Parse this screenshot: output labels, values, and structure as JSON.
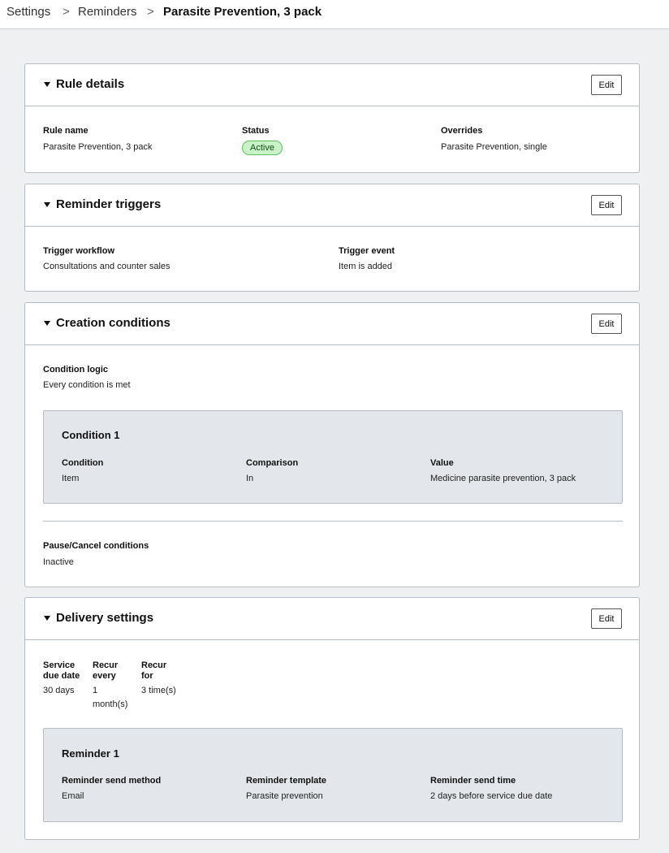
{
  "breadcrumb": {
    "items": [
      "Settings",
      "Reminders"
    ],
    "current": "Parasite Prevention, 3 pack",
    "separator": ">"
  },
  "edit_label": "Edit",
  "rule_details": {
    "title": "Rule details",
    "rule_name_label": "Rule name",
    "rule_name_value": "Parasite Prevention, 3 pack",
    "status_label": "Status",
    "status_value": "Active",
    "overrides_label": "Overrides",
    "overrides_value": "Parasite Prevention, single"
  },
  "reminder_triggers": {
    "title": "Reminder triggers",
    "workflow_label": "Trigger workflow",
    "workflow_value": "Consultations and counter sales",
    "event_label": "Trigger event",
    "event_value": "Item is added"
  },
  "creation_conditions": {
    "title": "Creation conditions",
    "logic_label": "Condition logic",
    "logic_value": "Every condition is met",
    "condition": {
      "title": "Condition 1",
      "condition_label": "Condition",
      "condition_value": "Item",
      "comparison_label": "Comparison",
      "comparison_value": "In",
      "value_label": "Value",
      "value_value": "Medicine parasite prevention, 3 pack"
    },
    "pause_label": "Pause/Cancel conditions",
    "pause_value": "Inactive"
  },
  "delivery_settings": {
    "title": "Delivery settings",
    "due_label_1": "Service",
    "due_label_2": "due date",
    "due_value": "30 days",
    "recur_every_label_1": "Recur",
    "recur_every_label_2": "every",
    "recur_every_value_1": "1",
    "recur_every_value_2": "month(s)",
    "recur_for_label_1": "Recur",
    "recur_for_label_2": "for",
    "recur_for_value": "3 time(s)",
    "reminder": {
      "title": "Reminder 1",
      "method_label": "Reminder send method",
      "method_value": "Email",
      "template_label": "Reminder template",
      "template_value": "Parasite prevention",
      "time_label": "Reminder send time",
      "time_value": "2 days before service due date"
    }
  },
  "colors": {
    "page_bg": "#eef0f1",
    "card_border": "#b7bdc5",
    "badge_bg": "#c9f2c9",
    "badge_border": "#5ec05e",
    "subbox_bg": "#e3e6ea"
  }
}
